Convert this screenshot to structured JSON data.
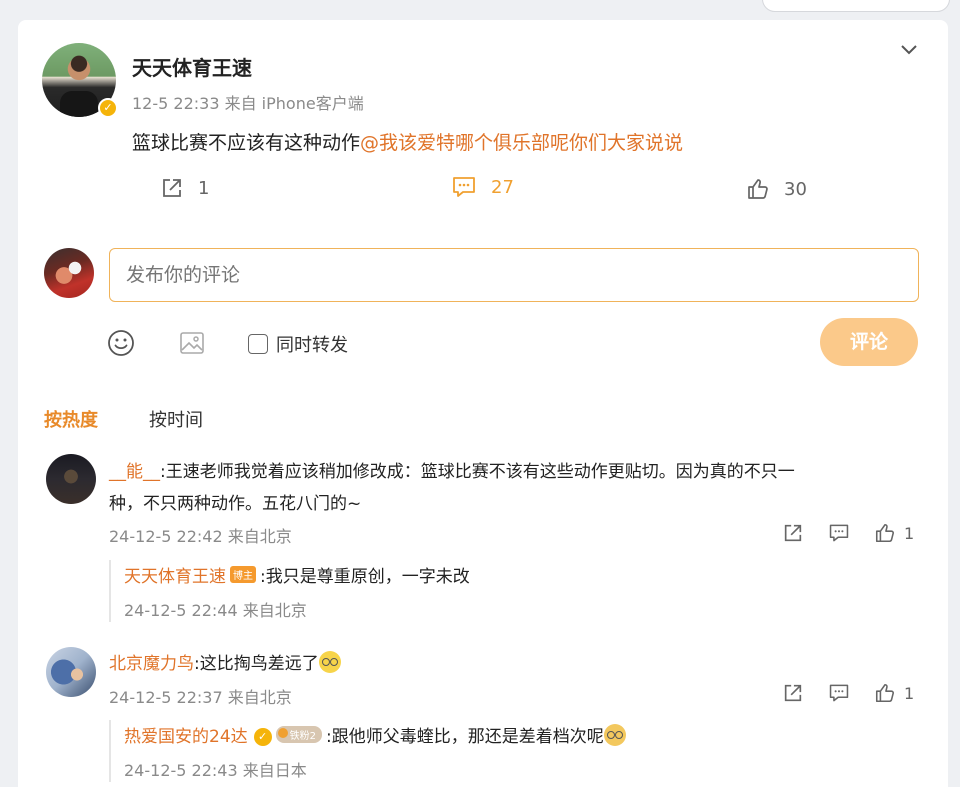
{
  "post": {
    "author": "天天体育王速",
    "meta": "12-5 22:33  来自 iPhone客户端",
    "text": "篮球比赛不应该有这种动作",
    "mention": "@我该爱特哪个俱乐部呢你们大家说说",
    "share_count": "1",
    "comment_count": "27",
    "like_count": "30"
  },
  "composer": {
    "placeholder": "发布你的评论",
    "repost_label": "同时转发",
    "submit_label": "评论"
  },
  "sort_tabs": {
    "hot": "按热度",
    "time": "按时间"
  },
  "comments": [
    {
      "user": "__能__",
      "text_line1": ":王速老师我觉着应该稍加修改成：篮球比赛不该有这些动作更贴切。因为真的不只一",
      "text_line2": "种，不只两种动作。五花八门的~",
      "time": "24-12-5 22:42 来自北京",
      "like_count": "1",
      "reply": {
        "user": "天天体育王速",
        "badge": "博主",
        "text": ":我只是尊重原创，一字未改",
        "time": "24-12-5 22:44 来自北京"
      }
    },
    {
      "user": "北京魔力鸟",
      "text": ":这比掏鸟差远了",
      "time": "24-12-5 22:37 来自北京",
      "like_count": "1",
      "reply": {
        "user": "热爱国安的24达",
        "badge": "铁粉2",
        "text": ":跟他师父毒蝰比，那还是差着档次呢",
        "time": "24-12-5 22:43 来自日本"
      }
    }
  ],
  "colors": {
    "accent": "#e0742a",
    "hot_tab": "#e88a2a",
    "submit_button": "#fbc98a",
    "input_border": "#f0b35a",
    "verified_badge": "#f5b40a"
  },
  "icons": [
    "chevron-down-icon",
    "share-icon",
    "comment-icon",
    "like-icon",
    "emoji-icon",
    "image-icon",
    "verified-icon"
  ]
}
